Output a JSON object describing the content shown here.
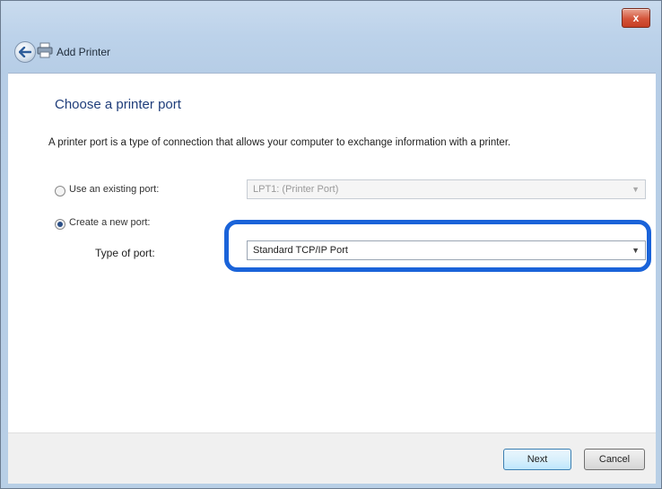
{
  "window": {
    "title": "Add Printer",
    "close_glyph": "x"
  },
  "page": {
    "heading": "Choose a printer port",
    "description": "A printer port is a type of connection that allows your computer to exchange information with a printer."
  },
  "options": {
    "existing_port": {
      "label": "Use an existing port:",
      "value": "LPT1: (Printer Port)",
      "selected": false
    },
    "new_port": {
      "label": "Create a new port:",
      "selected": true,
      "type_label": "Type of port:",
      "type_value": "Standard TCP/IP Port"
    }
  },
  "buttons": {
    "next": "Next",
    "cancel": "Cancel"
  },
  "colors": {
    "highlight": "#1a63d9",
    "heading": "#1f3d7a"
  }
}
